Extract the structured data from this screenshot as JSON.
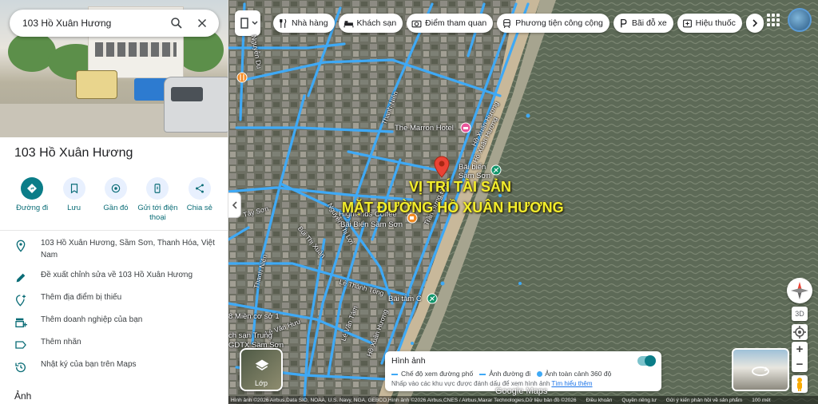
{
  "search": {
    "value": "103 Hồ Xuân Hương"
  },
  "place": {
    "title": "103 Hồ Xuân Hương",
    "actions": [
      "Đường đi",
      "Lưu",
      "Gần đó",
      "Gửi tới điện thoại",
      "Chia sẻ"
    ],
    "info": [
      {
        "icon": "location-pin-icon",
        "text": "103 Hồ Xuân Hương, Sầm Sơn, Thanh Hóa, Việt Nam"
      },
      {
        "icon": "pencil-icon",
        "text": "Đề xuất chỉnh sửa về 103 Hồ Xuân Hương"
      },
      {
        "icon": "add-location-icon",
        "text": "Thêm địa điểm bị thiếu"
      },
      {
        "icon": "add-business-icon",
        "text": "Thêm doanh nghiệp của bạn"
      },
      {
        "icon": "label-icon",
        "text": "Thêm nhãn"
      },
      {
        "icon": "history-icon",
        "text": "Nhật ký của bạn trên Maps"
      }
    ],
    "photos_heading": "Ảnh"
  },
  "chips": [
    "Nhà hàng",
    "Khách sạn",
    "Điểm tham quan",
    "Phương tiện công cộng",
    "Bãi đỗ xe",
    "Hiệu thuốc"
  ],
  "map": {
    "overlay_line1": "VỊ TRÍ TÀI SẢN",
    "overlay_line2": "MẶT ĐƯỜNG HỒ XUÂN HƯƠNG",
    "streets": [
      "Thanh Niên",
      "Hồ Xuân Hương",
      "Trần Hưng Đạo",
      "Tây Sơn",
      "Nguyễn Thị Lợi",
      "Bùi Thị Xuân",
      "Lê Thánh Tông",
      "Lê Văn Tám",
      "Lê Văn Hưu",
      "Thanh Niên",
      "Nguyễn Du",
      "Hồ Xuân Hương",
      "Hồ Xuân Hương"
    ],
    "pois": {
      "marron": "The Marron Hotel",
      "bai_bien_1": "Bãi biển",
      "bai_bien_2": "Sầm Sơn",
      "highlands_1": "Highlands Coffee",
      "highlands_2": "Bãi Biển Sầm Sơn",
      "bai_tam": "Bãi tắm C",
      "co_so_1": "8 Miền cơ sở 1",
      "ksan_trung": "ch sạn Trung",
      "gdtx": "GDTX Sầm Sơn"
    },
    "three_d": "3D"
  },
  "imagery_panel": {
    "title": "Hình ảnh",
    "legend": [
      "Chế độ xem đường phố",
      "Ảnh đường đi",
      "Ảnh toàn cảnh 360 độ"
    ],
    "note": "Nhấp vào các khu vực được đánh dấu để xem hình ảnh",
    "link": "Tìm hiểu thêm",
    "toggle_on": true
  },
  "layers_button": {
    "label": "Lớp"
  },
  "google_logo": "Google Maps",
  "footer": {
    "attribution": "Hình ảnh ©2026 Airbus,Data SIO, NOAA, U.S. Navy, NGA, GEBCO,Hình ảnh ©2026 Airbus,CNES / Airbus,Maxar Technologies,Dữ liệu bản đồ ©2026",
    "terms": "Điều khoản",
    "privacy": "Quyền riêng tư",
    "feedback": "Gửi ý kiến phản hồi về sản phẩm",
    "scale": "100 mét"
  },
  "colors": {
    "accent": "#0b7d88",
    "road_overlay": "#3fa9f5",
    "marker": "#ea4335",
    "overlay_text": "#f3ee2c",
    "sea": "#5d6a57"
  }
}
